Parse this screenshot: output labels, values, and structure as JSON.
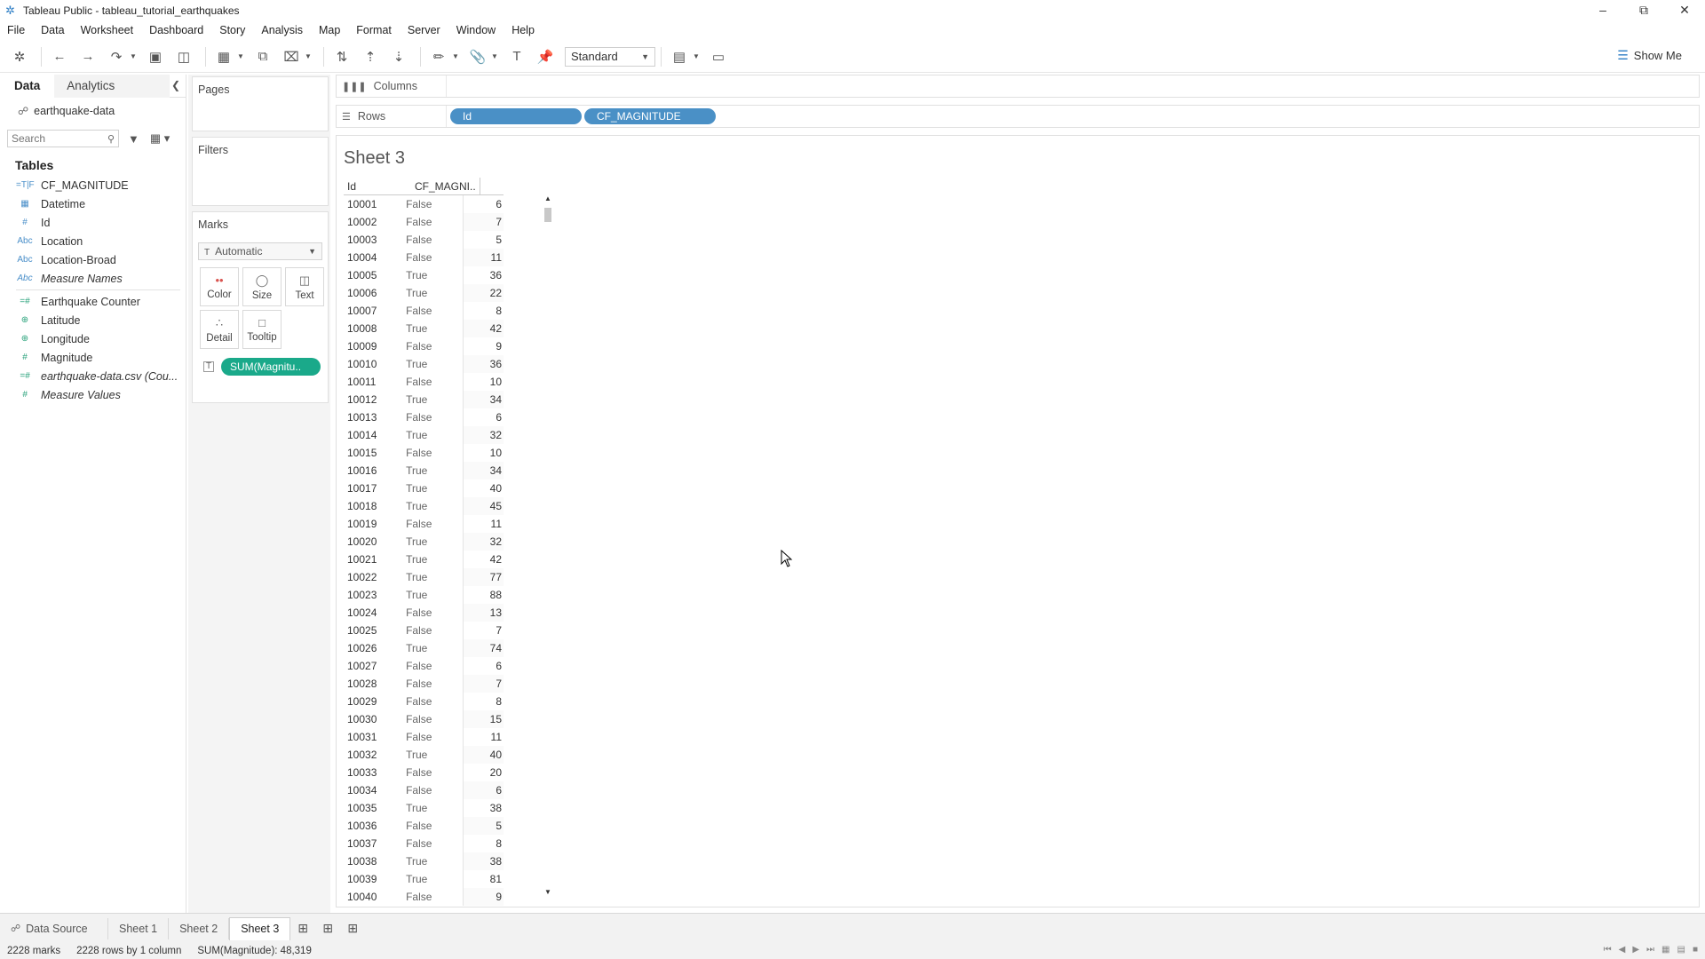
{
  "window": {
    "title": "Tableau Public - tableau_tutorial_earthquakes"
  },
  "menu": [
    "File",
    "Data",
    "Worksheet",
    "Dashboard",
    "Story",
    "Analysis",
    "Map",
    "Format",
    "Server",
    "Window",
    "Help"
  ],
  "toolbar": {
    "view_size": "Standard",
    "show_me": "Show Me"
  },
  "left_pane": {
    "tab_data": "Data",
    "tab_analytics": "Analytics",
    "datasource": "earthquake-data",
    "search_placeholder": "Search",
    "tables_heading": "Tables",
    "dimensions": [
      {
        "icon": "=T|F",
        "label": "CF_MAGNITUDE",
        "italic": false
      },
      {
        "icon": "date-icon",
        "label": "Datetime",
        "italic": false
      },
      {
        "icon": "#",
        "label": "Id",
        "italic": false
      },
      {
        "icon": "Abc",
        "label": "Location",
        "italic": false
      },
      {
        "icon": "Abc",
        "label": "Location-Broad",
        "italic": false
      },
      {
        "icon": "Abc",
        "label": "Measure Names",
        "italic": true
      }
    ],
    "measures": [
      {
        "icon": "=#",
        "label": "Earthquake Counter",
        "italic": false
      },
      {
        "icon": "globe-icon",
        "label": "Latitude",
        "italic": false
      },
      {
        "icon": "globe-icon",
        "label": "Longitude",
        "italic": false
      },
      {
        "icon": "#",
        "label": "Magnitude",
        "italic": false
      },
      {
        "icon": "=#",
        "label": "earthquake-data.csv (Cou...",
        "italic": true
      },
      {
        "icon": "#",
        "label": "Measure Values",
        "italic": true
      }
    ]
  },
  "cards": {
    "pages": "Pages",
    "filters": "Filters",
    "marks": "Marks",
    "mark_type": "Automatic",
    "mark_buttons": {
      "color": "Color",
      "size": "Size",
      "text": "Text",
      "detail": "Detail",
      "tooltip": "Tooltip"
    },
    "text_pill": "SUM(Magnitu.."
  },
  "shelves": {
    "columns_label": "Columns",
    "rows_label": "Rows",
    "row_pills": [
      "Id",
      "CF_MAGNITUDE"
    ]
  },
  "sheet": {
    "title": "Sheet 3",
    "headers": [
      "Id",
      "CF_MAGNI.."
    ],
    "rows": [
      [
        "10001",
        "False",
        "6"
      ],
      [
        "10002",
        "False",
        "7"
      ],
      [
        "10003",
        "False",
        "5"
      ],
      [
        "10004",
        "False",
        "11"
      ],
      [
        "10005",
        "True",
        "36"
      ],
      [
        "10006",
        "True",
        "22"
      ],
      [
        "10007",
        "False",
        "8"
      ],
      [
        "10008",
        "True",
        "42"
      ],
      [
        "10009",
        "False",
        "9"
      ],
      [
        "10010",
        "True",
        "36"
      ],
      [
        "10011",
        "False",
        "10"
      ],
      [
        "10012",
        "True",
        "34"
      ],
      [
        "10013",
        "False",
        "6"
      ],
      [
        "10014",
        "True",
        "32"
      ],
      [
        "10015",
        "False",
        "10"
      ],
      [
        "10016",
        "True",
        "34"
      ],
      [
        "10017",
        "True",
        "40"
      ],
      [
        "10018",
        "True",
        "45"
      ],
      [
        "10019",
        "False",
        "11"
      ],
      [
        "10020",
        "True",
        "32"
      ],
      [
        "10021",
        "True",
        "42"
      ],
      [
        "10022",
        "True",
        "77"
      ],
      [
        "10023",
        "True",
        "88"
      ],
      [
        "10024",
        "False",
        "13"
      ],
      [
        "10025",
        "False",
        "7"
      ],
      [
        "10026",
        "True",
        "74"
      ],
      [
        "10027",
        "False",
        "6"
      ],
      [
        "10028",
        "False",
        "7"
      ],
      [
        "10029",
        "False",
        "8"
      ],
      [
        "10030",
        "False",
        "15"
      ],
      [
        "10031",
        "False",
        "11"
      ],
      [
        "10032",
        "True",
        "40"
      ],
      [
        "10033",
        "False",
        "20"
      ],
      [
        "10034",
        "False",
        "6"
      ],
      [
        "10035",
        "True",
        "38"
      ],
      [
        "10036",
        "False",
        "5"
      ],
      [
        "10037",
        "False",
        "8"
      ],
      [
        "10038",
        "True",
        "38"
      ],
      [
        "10039",
        "True",
        "81"
      ],
      [
        "10040",
        "False",
        "9"
      ]
    ]
  },
  "sheet_tabs": [
    "Data Source",
    "Sheet 1",
    "Sheet 2",
    "Sheet 3"
  ],
  "active_tab": "Sheet 3",
  "status": {
    "marks": "2228 marks",
    "dims": "2228 rows by 1 column",
    "sum": "SUM(Magnitude): 48,319"
  },
  "colors": {
    "dimension_pill": "#4a90c6",
    "measure_pill": "#1aa98a"
  }
}
